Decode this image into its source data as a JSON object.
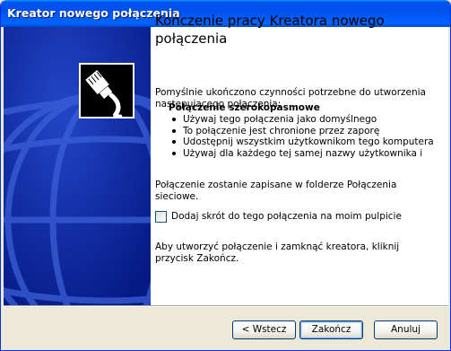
{
  "window": {
    "title": "Kreator nowego połączenia"
  },
  "main": {
    "heading": "Kończenie pracy Kreatora nowego połączenia",
    "intro": "Pomyślnie ukończono czynności potrzebne do utworzenia następującego połączenia:",
    "summary": {
      "title": "Połączenie szerokopasmowe",
      "items": [
        "Używaj tego połączenia jako domyślnego",
        "To połączenie jest chronione przez zaporę",
        "Udostępnij wszystkim użytkownikom tego komputera",
        "Używaj dla każdego tej samej nazwy użytkownika i"
      ]
    },
    "save_note": "Połączenie zostanie zapisane w folderze Połączenia sieciowe.",
    "shortcut_checkbox": {
      "label": "Dodaj skrót do tego połączenia na moim pulpicie",
      "checked": false
    },
    "finish_note": "Aby utworzyć połączenie i zamknąć kreatora, kliknij przycisk Zakończ."
  },
  "buttons": {
    "back": "< Wstecz",
    "finish": "Zakończ",
    "cancel": "Anuluj"
  },
  "icons": {
    "side_icon": "network-cable-icon"
  },
  "colors": {
    "titlebar": "#0053ee",
    "side_panel": "#0a27a3",
    "globe_lines": "#2b4fc4"
  }
}
